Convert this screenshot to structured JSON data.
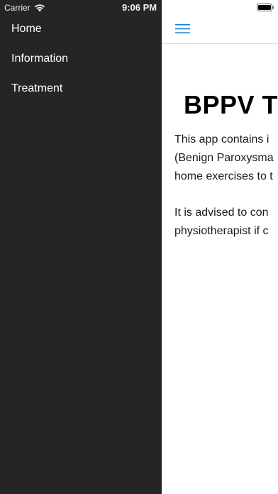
{
  "status_bar": {
    "carrier": "Carrier",
    "time": "9:06 PM"
  },
  "drawer": {
    "items": [
      {
        "label": "Home"
      },
      {
        "label": "Information"
      },
      {
        "label": "Treatment"
      }
    ]
  },
  "main": {
    "title": "BPPV Tr",
    "paragraphs": [
      {
        "lines": [
          "This app contains i",
          "(Benign Paroxysma",
          "home exercises to t"
        ]
      },
      {
        "lines": [
          "It is advised to con",
          "physiotherapist if c"
        ]
      }
    ]
  },
  "colors": {
    "drawer_bg": "#252525",
    "accent": "#1e7fd4",
    "text": "#1a1a1a"
  }
}
